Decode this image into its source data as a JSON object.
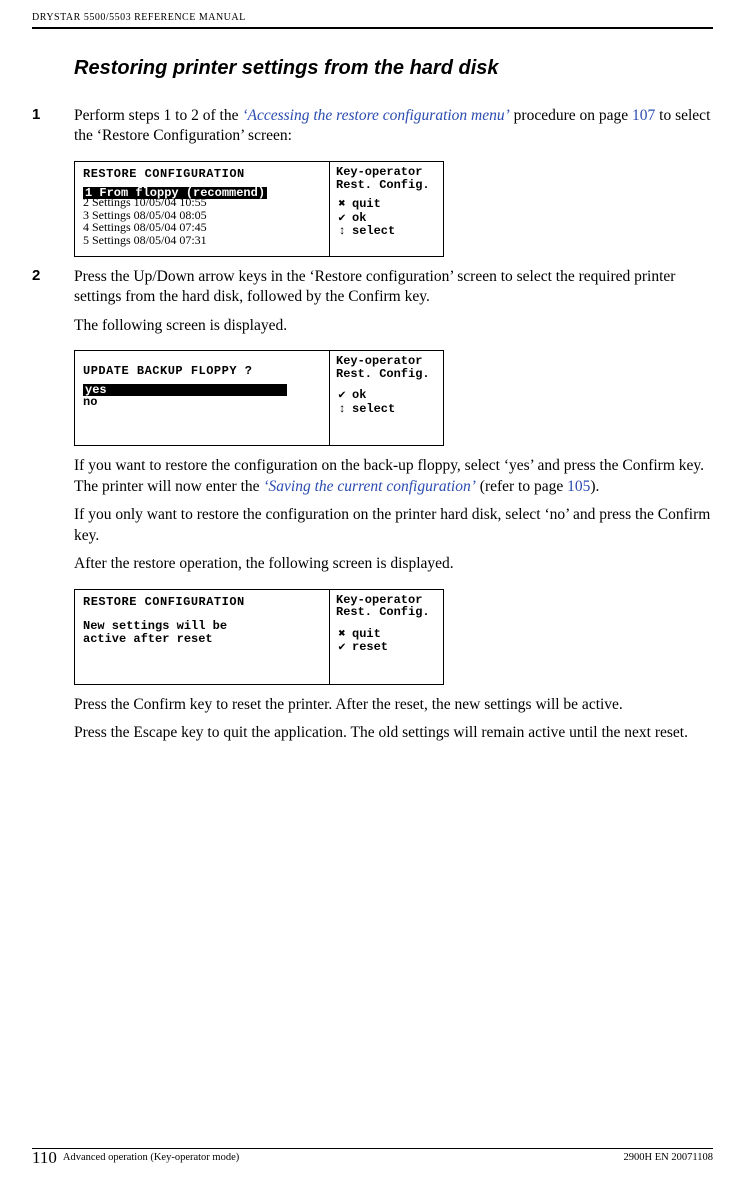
{
  "header": {
    "running": "DRYSTAR 5500/5503 REFERENCE MANUAL"
  },
  "section": {
    "title": "Restoring printer settings from the hard disk"
  },
  "steps": {
    "s1": {
      "num": "1",
      "pre": "Perform steps 1 to 2 of the ",
      "link": "‘Accessing the restore configuration menu’",
      "mid": " procedure on page ",
      "page": "107",
      "post": " to select the ‘Restore Configuration’ screen:"
    },
    "s2": {
      "num": "2",
      "p1": "Press the Up/Down arrow keys in the ‘Restore configuration’ screen to select the required printer settings from the hard disk, followed by the Confirm key.",
      "p2": "The following screen is displayed.",
      "p3a": "If you want to restore the configuration on the back-up floppy, select ‘yes’ and press the Confirm key. The printer will now enter the ",
      "p3link": "‘Saving the current configuration’",
      "p3b": " (refer to page ",
      "p3page": "105",
      "p3c": ").",
      "p4": "If you only want to restore the configuration on the printer hard disk, select ‘no’ and press the Confirm key.",
      "p5": "After the restore operation, the following screen is displayed.",
      "p6": "Press the Confirm key to reset the printer. After the reset, the new settings will be active.",
      "p7": "Press the Escape key to quit the application. The old settings will remain active until the next reset."
    }
  },
  "lcd1": {
    "title": "RESTORE CONFIGURATION",
    "sel": "1 From floppy (recommend)",
    "rows": {
      "r2": "2 Settings 10/05/04 10:55",
      "r3": "3 Settings 08/05/04 08:05",
      "r4": "4 Settings 08/05/04 07:45",
      "r5": "5 Settings 08/05/04 07:31"
    },
    "side": {
      "l1": "Key-operator",
      "l2": "Rest. Config.",
      "k1": "quit",
      "k2": "ok",
      "k3": "select"
    }
  },
  "lcd2": {
    "title": "UPDATE BACKUP FLOPPY ?",
    "sel": "yes",
    "row": "no",
    "side": {
      "l1": "Key-operator",
      "l2": "Rest. Config.",
      "k1": "ok",
      "k2": "select"
    }
  },
  "lcd3": {
    "title": "RESTORE CONFIGURATION",
    "row1": "New settings will be",
    "row2": "active after reset",
    "side": {
      "l1": "Key-operator",
      "l2": "Rest. Config.",
      "k1": "quit",
      "k2": "reset"
    }
  },
  "footer": {
    "page": "110",
    "left": "Advanced operation (Key-operator mode)",
    "right": "2900H EN 20071108"
  }
}
